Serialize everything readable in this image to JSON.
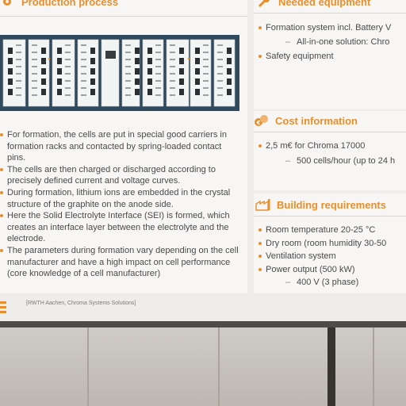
{
  "production": {
    "title": "Production process",
    "bullets": [
      "For formation, the cells are put in special good carriers in formation racks and contacted by spring-loaded contact pins.",
      "The cells are then charged or discharged according to precisely defined current and voltage curves.",
      "During formation, lithium ions are embedded in the crystal structure of the graphite on the anode side.",
      "Here the Solid Electrolyte Interface (SEI) is formed, which creates an interface layer between the electrolyte and the electrode.",
      "The parameters during formation vary depending on the cell manufacturer and have a high impact on cell performance (core knowledge of a cell manufacturer)"
    ]
  },
  "equipment": {
    "title": "Needed equipment",
    "items": [
      {
        "text": "Formation system incl. Battery V",
        "level": 0
      },
      {
        "text": "All-in-one solution: Chro",
        "level": 1
      },
      {
        "text": "Safety equipment",
        "level": 0
      }
    ]
  },
  "cost": {
    "title": "Cost information",
    "items": [
      {
        "text": "2,5 m€ for Chroma 17000",
        "level": 0
      },
      {
        "text": "500 cells/hour (up to 24 h",
        "level": 1
      }
    ]
  },
  "building": {
    "title": "Building requirements",
    "items": [
      {
        "text": "Room temperature 20-25 °C",
        "level": 0
      },
      {
        "text": "Dry room (room humidity 30-50",
        "level": 0
      },
      {
        "text": "Ventilation system",
        "level": 0
      },
      {
        "text": "Power output (500 kW)",
        "level": 0
      },
      {
        "text": "400 V (3 phase)",
        "level": 1
      }
    ]
  },
  "footer": {
    "source": "[RWTH Aachen, Chroma Systems Solutions]"
  },
  "colors": {
    "accent": "#e88f2c",
    "text": "#4a4a4a",
    "panel": "#f7f6f4",
    "board": "#eeedeb"
  }
}
